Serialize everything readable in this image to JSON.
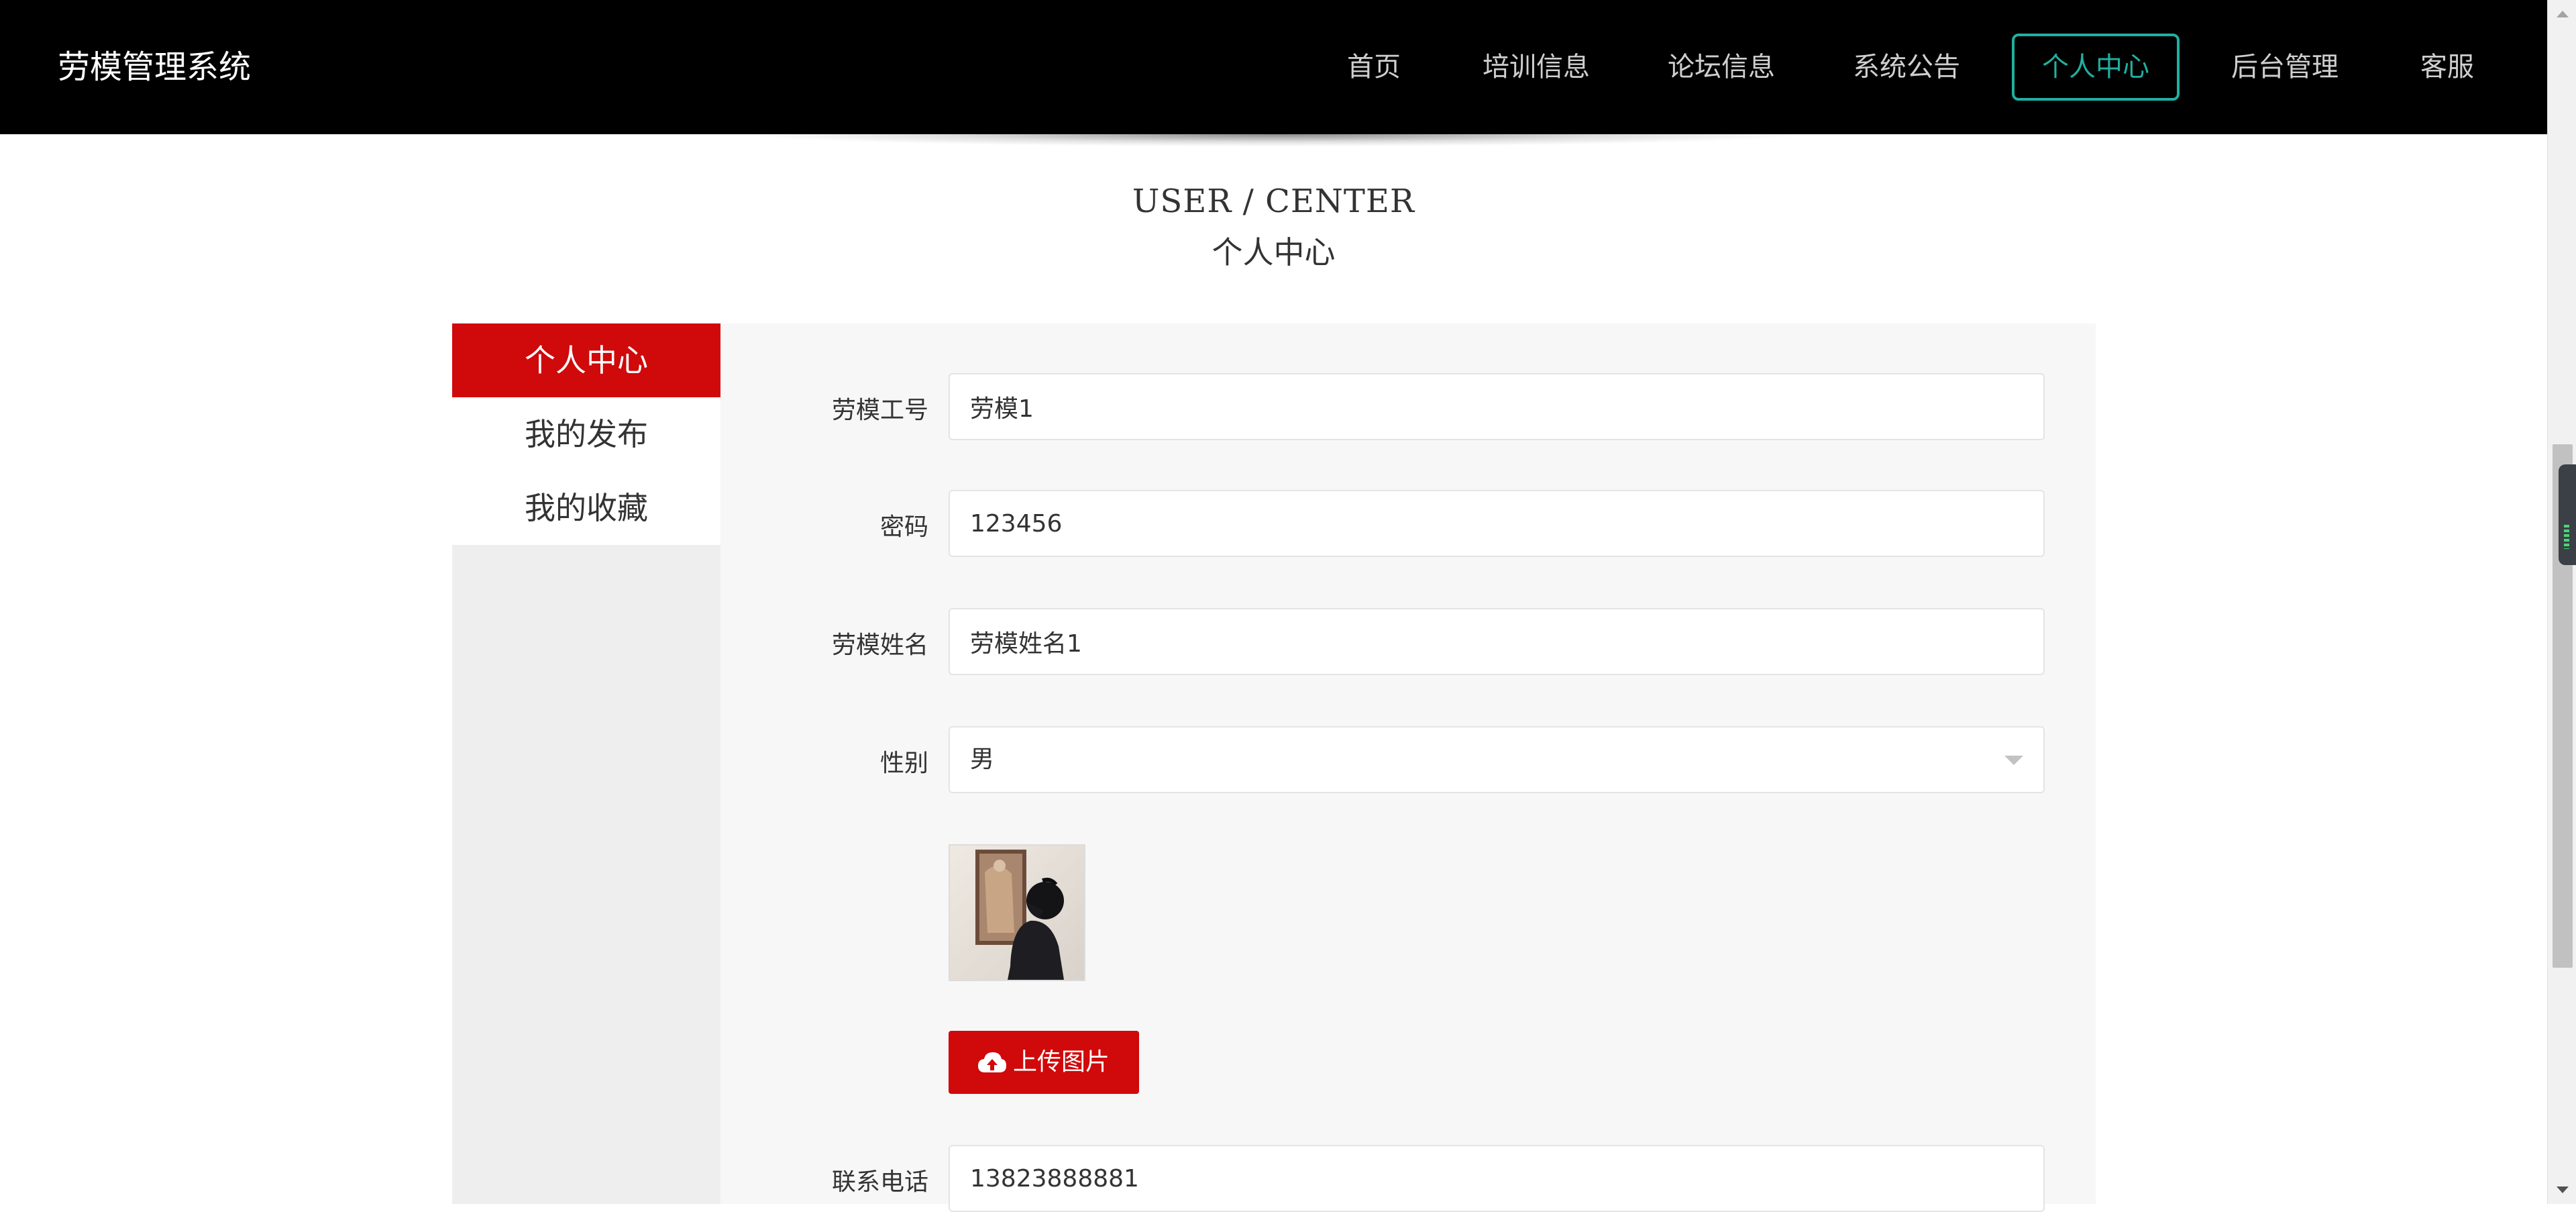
{
  "header": {
    "logo": "劳模管理系统",
    "nav": [
      {
        "label": "首页"
      },
      {
        "label": "培训信息"
      },
      {
        "label": "论坛信息"
      },
      {
        "label": "系统公告"
      },
      {
        "label": "个人中心",
        "active": true
      },
      {
        "label": "后台管理"
      },
      {
        "label": "客服"
      }
    ]
  },
  "page": {
    "title_en": "USER / CENTER",
    "title_cn": "个人中心"
  },
  "sidebar": {
    "items": [
      {
        "label": "个人中心",
        "active": true
      },
      {
        "label": "我的发布"
      },
      {
        "label": "我的收藏"
      }
    ]
  },
  "form": {
    "employee_id": {
      "label": "劳模工号",
      "value": "劳模1"
    },
    "password": {
      "label": "密码",
      "value": "123456"
    },
    "name": {
      "label": "劳模姓名",
      "value": "劳模姓名1"
    },
    "gender": {
      "label": "性别",
      "value": "男"
    },
    "upload": {
      "label": "上传图片",
      "icon": "cloud-upload-icon"
    },
    "phone": {
      "label": "联系电话",
      "value": "13823888881"
    }
  },
  "colors": {
    "nav_bg": "#000000",
    "accent_teal": "#1fb0a1",
    "brand_red": "#d0090b",
    "panel_bg": "#f7f7f7",
    "sidebar_bg": "#eeeeee"
  }
}
